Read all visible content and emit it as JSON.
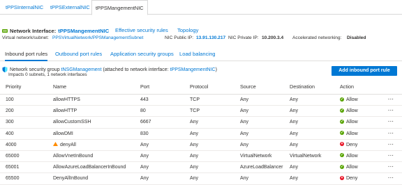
{
  "nic_tabs": [
    {
      "label": "tPPSInternalNIC",
      "active": false
    },
    {
      "label": "tPPSExternalNIC",
      "active": false
    },
    {
      "label": "tPPSMangementNIC",
      "active": true
    }
  ],
  "interface": {
    "label": "Network Interface:",
    "name": "tPPSMangementNIC",
    "effective_security_rules": "Effective security rules",
    "topology": "Topology"
  },
  "meta": {
    "vnet_label": "Virtual network/subnet:",
    "vnet_value": "PPSVirtualNetwork/PPSManagementSubnet",
    "public_ip_label": "NIC Public IP:",
    "public_ip_value": "13.91.130.217",
    "private_ip_label": "NIC Private IP:",
    "private_ip_value": "10.200.3.4",
    "accel_label": "Accelerated networking:",
    "accel_value": "Disabled"
  },
  "rule_tabs": [
    {
      "label": "Inbound port rules",
      "active": true
    },
    {
      "label": "Outbound port rules",
      "active": false
    },
    {
      "label": "Application security groups",
      "active": false
    },
    {
      "label": "Load balancing",
      "active": false
    }
  ],
  "nsg": {
    "prefix": "Network security group",
    "name": "tNSGManagement",
    "middle": "(attached to network interface:",
    "nic": "tPPSMangementNIC",
    "suffix": ")",
    "impacts": "Impacts 0 subnets, 1 network interfaces",
    "add_button": "Add inbound port rule"
  },
  "table": {
    "headers": {
      "priority": "Priority",
      "name": "Name",
      "port": "Port",
      "protocol": "Protocol",
      "source": "Source",
      "destination": "Destination",
      "action": "Action"
    },
    "more_label": "···",
    "rows": [
      {
        "priority": "100",
        "name": "allowHTTPS",
        "port": "443",
        "protocol": "TCP",
        "source": "Any",
        "destination": "Any",
        "action": "Allow",
        "warning": false
      },
      {
        "priority": "200",
        "name": "allowHTTP",
        "port": "80",
        "protocol": "TCP",
        "source": "Any",
        "destination": "Any",
        "action": "Allow",
        "warning": false
      },
      {
        "priority": "300",
        "name": "allowCustomSSH",
        "port": "6667",
        "protocol": "Any",
        "source": "Any",
        "destination": "Any",
        "action": "Allow",
        "warning": false
      },
      {
        "priority": "400",
        "name": "allowDMI",
        "port": "830",
        "protocol": "Any",
        "source": "Any",
        "destination": "Any",
        "action": "Allow",
        "warning": false
      },
      {
        "priority": "4000",
        "name": "denyAll",
        "port": "Any",
        "protocol": "Any",
        "source": "Any",
        "destination": "Any",
        "action": "Deny",
        "warning": true
      },
      {
        "priority": "65000",
        "name": "AllowVnetInBound",
        "port": "Any",
        "protocol": "Any",
        "source": "VirtualNetwork",
        "destination": "VirtualNetwork",
        "action": "Allow",
        "warning": false
      },
      {
        "priority": "65001",
        "name": "AllowAzureLoadBalancerInBound",
        "port": "Any",
        "protocol": "Any",
        "source": "AzureLoadBalancer",
        "destination": "Any",
        "action": "Allow",
        "warning": false
      },
      {
        "priority": "65500",
        "name": "DenyAllInBound",
        "port": "Any",
        "protocol": "Any",
        "source": "Any",
        "destination": "Any",
        "action": "Deny",
        "warning": false
      }
    ]
  },
  "colors": {
    "accent": "#0078d4",
    "allow": "#57a300",
    "deny": "#e81123",
    "warning": "#ff8c00"
  }
}
